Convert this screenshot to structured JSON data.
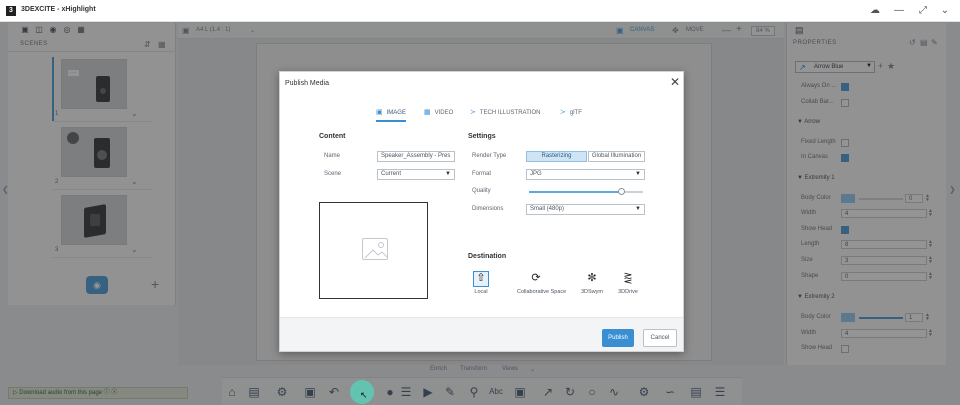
{
  "window": {
    "title": "3DEXCITE - xHighlight",
    "logo_letter": "3",
    "controls": [
      "☁",
      "—",
      "⤢",
      "⌄"
    ]
  },
  "left_panel": {
    "toolbar_icons": [
      "camera-icon",
      "cube-icon",
      "layers-icon",
      "target-icon",
      "film-icon"
    ],
    "scenes_label": "SCENES",
    "scenes": [
      {
        "num": "1",
        "thumb_label": "····"
      },
      {
        "num": "2",
        "thumb_label": ""
      },
      {
        "num": "3",
        "thumb_label": ""
      }
    ],
    "add_label": "+"
  },
  "canvas_toolbar": {
    "page_size": "A4 L (1.4 : 1)",
    "canvas_label": "CANVAS",
    "move_label": "MOVE",
    "zoom": "84 %"
  },
  "right_panel": {
    "header": "PROPERTIES",
    "style_select": "Arrow Blue",
    "always_on": "Always On ...",
    "collab_bar": "Collab Bar...",
    "arrow_section": "Arrow",
    "fixed_length": "Fixed Length",
    "in_canvas": "In Canvas",
    "extremity1_section": "Extremity 1",
    "body_color": "Body Color",
    "body_color_value": "0",
    "width_label": "Width",
    "width_value": "4",
    "show_head": "Show Head",
    "length_label": "Length",
    "length_value": "8",
    "size_label": "Size",
    "size_value": "3",
    "shape_label": "Shape",
    "shape_value": "0",
    "extremity2_section": "Extremity 2",
    "body_color2_value": "1",
    "width2_value": "4",
    "show_head2": "Show Head"
  },
  "dialog": {
    "title": "Publish Media",
    "close": "✕",
    "tabs": [
      {
        "label": "IMAGE",
        "icon": "image-icon",
        "active": true
      },
      {
        "label": "VIDEO",
        "icon": "video-icon",
        "active": false
      },
      {
        "label": "TECH ILLUSTRATION",
        "icon": "share-icon",
        "active": false
      },
      {
        "label": "glTF",
        "icon": "share-icon",
        "active": false
      }
    ],
    "content_title": "Content",
    "name_label": "Name",
    "name_value": "Speaker_Assembly - Pres",
    "scene_label": "Scene",
    "scene_value": "Current",
    "settings_title": "Settings",
    "render_type_label": "Render Type",
    "render_options": [
      "Rasterizing",
      "Global Illumination"
    ],
    "format_label": "Format",
    "format_value": "JPG",
    "quality_label": "Quality",
    "quality_value": 0.82,
    "dimensions_label": "Dimensions",
    "dimensions_value": "Small (480p)",
    "destination_title": "Destination",
    "destinations": [
      {
        "label": "Local",
        "icon": "upload-icon"
      },
      {
        "label": "Collaborative Space",
        "icon": "sync-icon"
      },
      {
        "label": "3DSwym",
        "icon": "swym-icon"
      },
      {
        "label": "3DDrive",
        "icon": "share-icon"
      }
    ],
    "publish_label": "Publish",
    "cancel_label": "Cancel"
  },
  "bottom": {
    "tabs": [
      "Enrich",
      "Transform",
      "Views"
    ],
    "download_bar": "▷ Download audio from this page ⓘ ⓧ"
  }
}
